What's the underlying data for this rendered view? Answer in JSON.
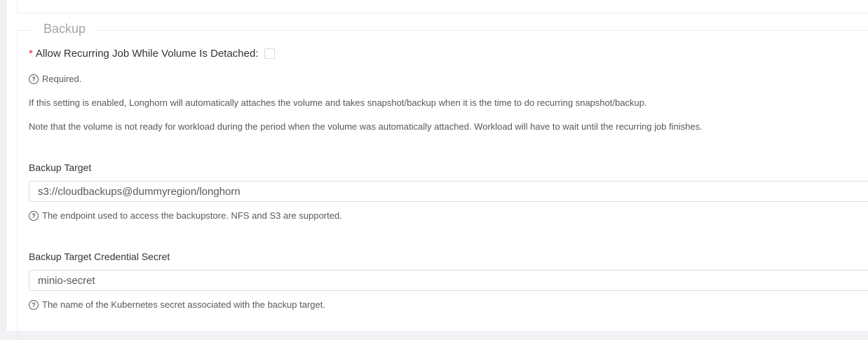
{
  "section": {
    "legend": "Backup"
  },
  "recurring_job": {
    "required_mark": "*",
    "label": "Allow Recurring Job While Volume Is Detached:",
    "checked": false,
    "help_text": "Required.",
    "description_1": "If this setting is enabled, Longhorn will automatically attaches the volume and takes snapshot/backup when it is the time to do recurring snapshot/backup.",
    "description_2": "Note that the volume is not ready for workload during the period when the volume was automatically attached. Workload will have to wait until the recurring job finishes."
  },
  "backup_target": {
    "label": "Backup Target",
    "value": "s3://cloudbackups@dummyregion/longhorn",
    "help_text": "The endpoint used to access the backupstore. NFS and S3 are supported."
  },
  "credential_secret": {
    "label": "Backup Target Credential Secret",
    "value": "minio-secret",
    "help_text": "The name of the Kubernetes secret associated with the backup target."
  },
  "icons": {
    "help": "question-circle-icon",
    "help_glyph": "?"
  }
}
